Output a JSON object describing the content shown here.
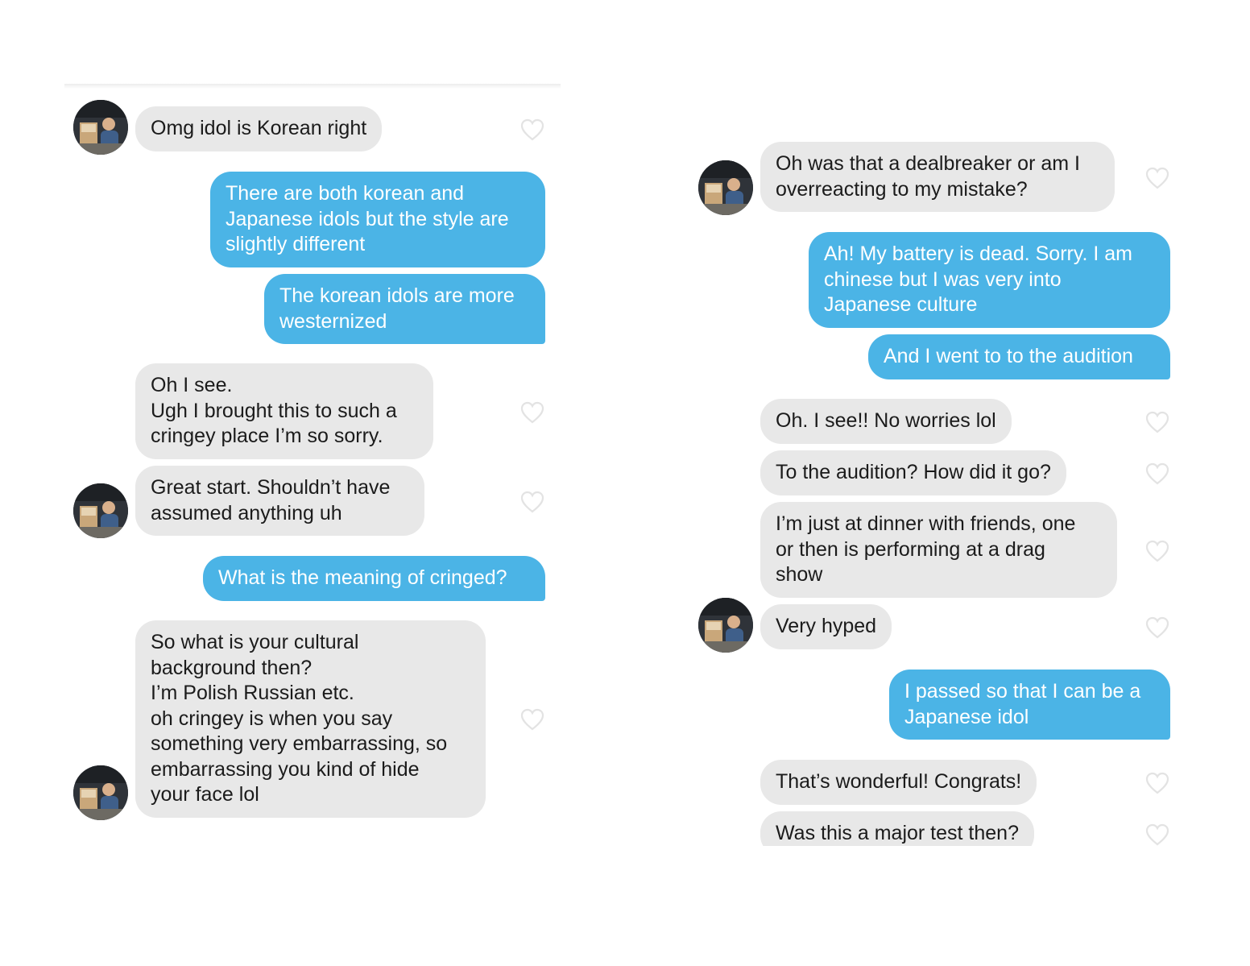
{
  "colors": {
    "incoming_bubble": "#e8e8e8",
    "outgoing_bubble": "#4bb4e6",
    "heart_outline": "#e3e3e3"
  },
  "icons": {
    "like": "heart-outline-icon",
    "avatar": "profile-photo"
  },
  "left_chat": {
    "messages": [
      {
        "from": "them",
        "text": "Omg idol is Korean right"
      },
      {
        "from": "me",
        "text": "There are both korean and\nJapanese idols but the style are\nslightly different"
      },
      {
        "from": "me",
        "text": "The korean idols are more\nwesternized"
      },
      {
        "from": "them",
        "text": "Oh I see.\nUgh I brought this to such a\ncringey place I’m so sorry."
      },
      {
        "from": "them",
        "text": "Great start. Shouldn’t have\nassumed anything uh"
      },
      {
        "from": "me",
        "text": "What is the meaning of cringed?"
      },
      {
        "from": "them",
        "text": "So what is your cultural\nbackground then?\nI’m Polish Russian etc.\noh cringey is when you say\nsomething very embarrassing, so\nembarrassing you kind of hide\nyour face lol"
      }
    ]
  },
  "right_chat": {
    "messages": [
      {
        "from": "them",
        "text": "Oh was that a dealbreaker or am I\noverreacting to my mistake?"
      },
      {
        "from": "me",
        "text": "Ah! My battery is dead. Sorry. I am\nchinese but I was very into\nJapanese culture"
      },
      {
        "from": "me",
        "text": "And I went to to the audition"
      },
      {
        "from": "them",
        "text": "Oh. I see!! No worries lol"
      },
      {
        "from": "them",
        "text": "To the audition? How did it go?"
      },
      {
        "from": "them",
        "text": "I’m just at dinner with friends, one\nor then is performing at a drag\nshow"
      },
      {
        "from": "them",
        "text": "Very hyped"
      },
      {
        "from": "me",
        "text": "I passed so that I can be a\nJapanese idol"
      },
      {
        "from": "them",
        "text": "That’s wonderful! Congrats!"
      },
      {
        "from": "them",
        "text": "Was this a major test then?"
      }
    ]
  }
}
